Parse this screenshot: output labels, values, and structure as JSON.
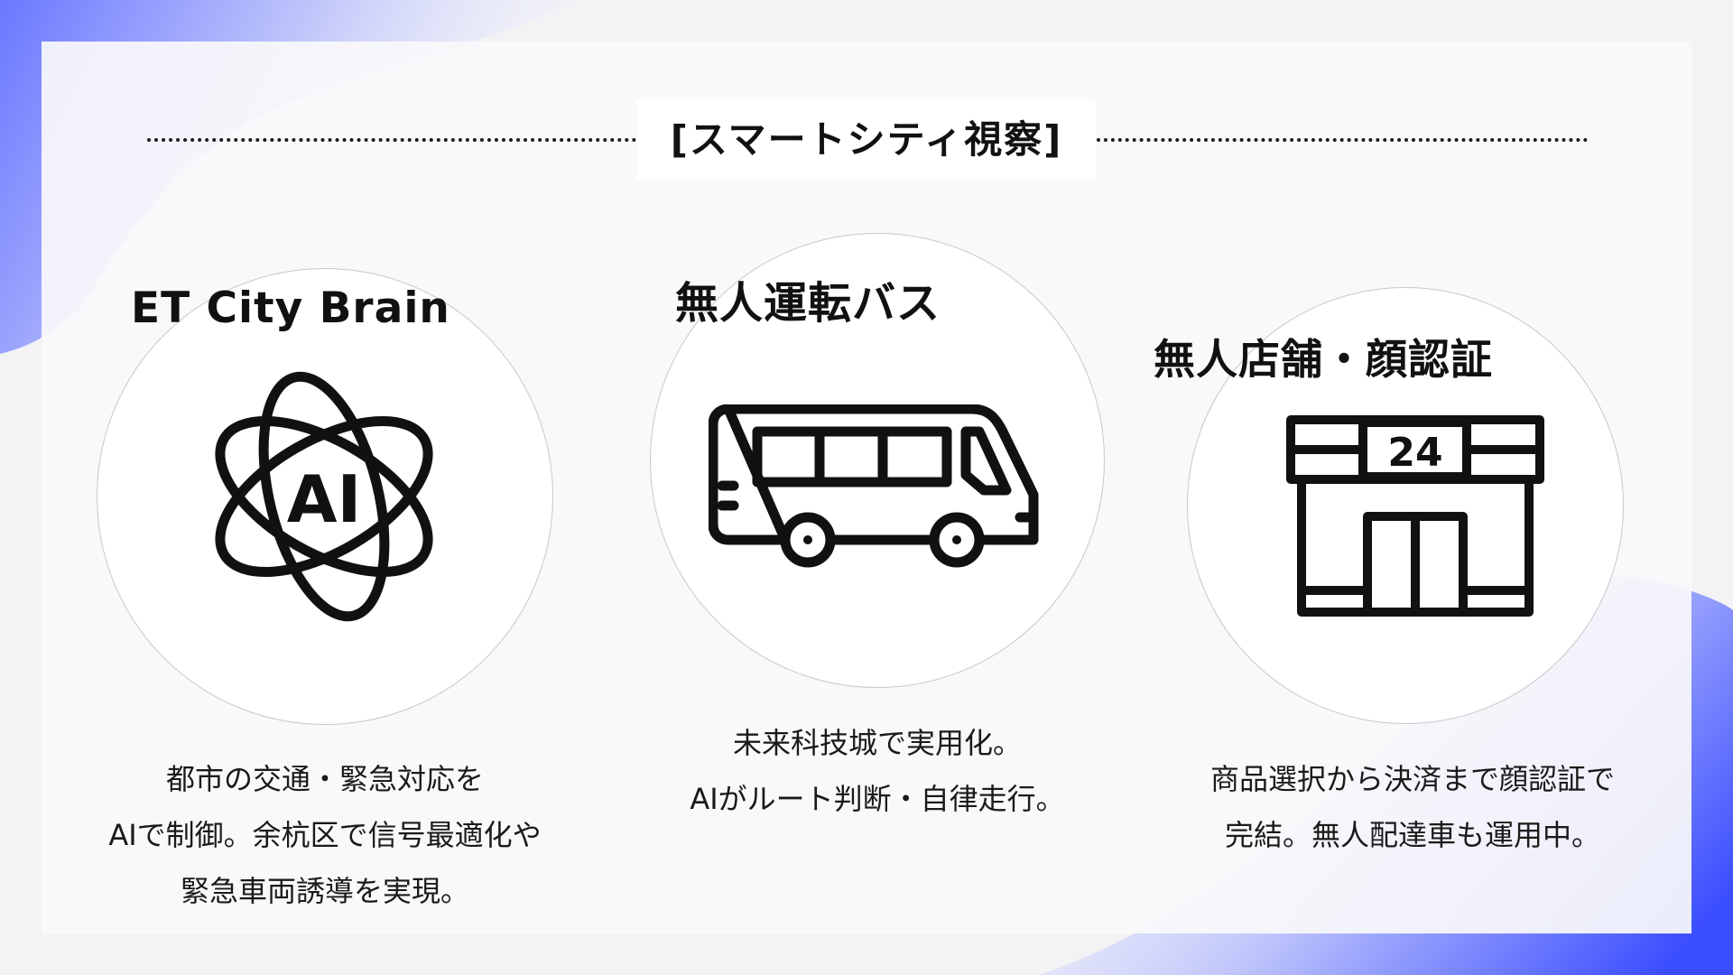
{
  "slide": {
    "title": "[スマートシティ視察]"
  },
  "sections": [
    {
      "heading": "ET City Brain",
      "icon": "ai-atom-icon",
      "icon_text": "AI",
      "lines": [
        "都市の交通・緊急対応を",
        "AIで制御。余杭区で信号最適化や",
        "緊急車両誘導を実現。"
      ]
    },
    {
      "heading": "無人運転バス",
      "icon": "bus-icon",
      "lines": [
        "未来科技城で実用化。",
        "AIがルート判断・自律走行。"
      ]
    },
    {
      "heading": "無人店舗・顔認証",
      "icon": "convenience-store-24-icon",
      "icon_text": "24",
      "lines": [
        "商品選択から決済まで顔認証で",
        "完結。無人配達車も運用中。"
      ]
    }
  ],
  "colors": {
    "accent_blue": "#4a5cff",
    "card": "#f9f9fb",
    "text": "#111111"
  }
}
